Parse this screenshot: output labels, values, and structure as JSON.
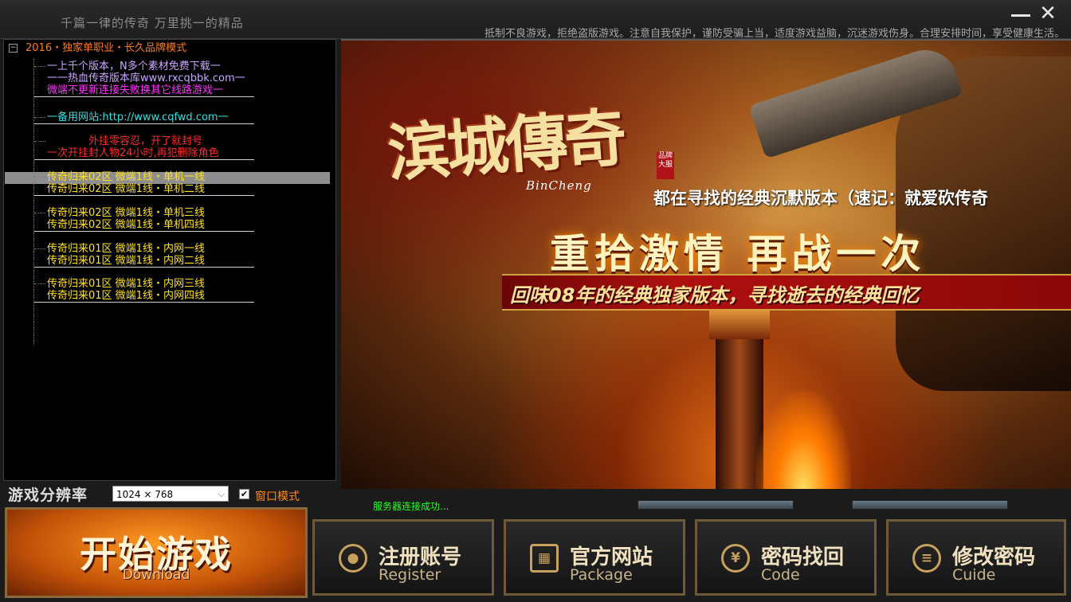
{
  "title_bar": {
    "slogan": "千篇一律的传奇  万里挑一的精品",
    "notice": "抵制不良游戏，拒绝盗版游戏。注意自我保护，谨防受骗上当，适度游戏益脑，沉迷游戏伤身。合理安排时间，享受健康生活。",
    "minimize_icon": "minimize-icon",
    "close_icon": "close-icon"
  },
  "server_tree": {
    "root_label": "2016・独家单职业・长久品牌模式",
    "expander": "−",
    "nodes": [
      {
        "lines": [
          "一上千个版本，N多个素材免费下载一",
          "一一热血传奇版本库www.rxcqbbk.com一",
          "微端不更新连接失败换其它线路游戏一"
        ],
        "colors": [
          "#c9a6ff",
          "#c9a6ff",
          "#ff33ff"
        ]
      },
      {
        "lines": [
          "一备用网站:http://www.cqfwd.com一"
        ],
        "colors": [
          "#33e0e0"
        ]
      },
      {
        "lines": [
          "外挂零容忍，开了就封号",
          "一次开挂封人物24小时,再犯删除角色"
        ],
        "colors": [
          "#ff2a2a",
          "#ff2a2a"
        ]
      },
      {
        "lines": [
          "传奇归来02区   微端1线・单机一线",
          "传奇归来02区   微端1线・单机二线"
        ],
        "colors": [
          "#ffe020",
          "#ffe020"
        ]
      },
      {
        "lines": [
          "传奇归来02区   微端1线・单机三线",
          "传奇归来02区   微端1线・单机四线"
        ],
        "colors": [
          "#ffe020",
          "#ffe020"
        ]
      },
      {
        "lines": [
          "传奇归来01区   微端1线・内网一线",
          "传奇归来01区   微端1线・内网二线"
        ],
        "colors": [
          "#ffe020",
          "#ffe020"
        ]
      },
      {
        "lines": [
          "传奇归来01区   微端1线・内网三线",
          "传奇归来01区   微端1线・内网四线"
        ],
        "colors": [
          "#ffe020",
          "#ffe020"
        ]
      }
    ],
    "selected_line": "传奇归来02区   微端1线・单机一线"
  },
  "banner": {
    "logo_text": "滨城傳奇",
    "logo_en": "BinCheng",
    "seal_text": "品牌大服",
    "tagline": "都在寻找的经典沉默版本（速记：就爱砍传奇",
    "headline": "重拾激情  再战一次",
    "ribbon": "回味08年的经典独家版本，寻找逝去的经典回忆"
  },
  "settings": {
    "resolution_label": "游戏分辨率",
    "resolution_value": "1024 × 768",
    "window_mode_label": "窗口模式",
    "window_mode_checked": true,
    "status_text": "服务器连接成功..."
  },
  "buttons": {
    "start": {
      "main": "开始游戏",
      "sub": "Download"
    },
    "register": {
      "main": "注册账号",
      "sub": "Register",
      "icon": "user-icon"
    },
    "website": {
      "main": "官方网站",
      "sub": "Package",
      "icon": "gift-icon"
    },
    "recover": {
      "main": "密码找回",
      "sub": "Code",
      "icon": "yen-icon"
    },
    "change_pw": {
      "main": "修改密码",
      "sub": "Cuide",
      "icon": "list-icon"
    }
  }
}
